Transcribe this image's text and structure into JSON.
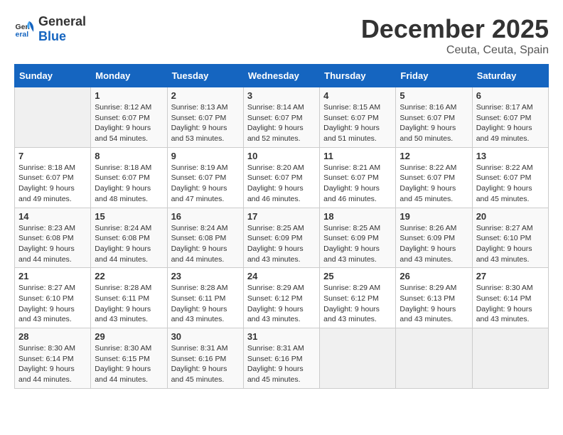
{
  "header": {
    "logo_general": "General",
    "logo_blue": "Blue",
    "month": "December 2025",
    "location": "Ceuta, Ceuta, Spain"
  },
  "weekdays": [
    "Sunday",
    "Monday",
    "Tuesday",
    "Wednesday",
    "Thursday",
    "Friday",
    "Saturday"
  ],
  "weeks": [
    [
      {
        "day": "",
        "sunrise": "",
        "sunset": "",
        "daylight": ""
      },
      {
        "day": "1",
        "sunrise": "Sunrise: 8:12 AM",
        "sunset": "Sunset: 6:07 PM",
        "daylight": "Daylight: 9 hours and 54 minutes."
      },
      {
        "day": "2",
        "sunrise": "Sunrise: 8:13 AM",
        "sunset": "Sunset: 6:07 PM",
        "daylight": "Daylight: 9 hours and 53 minutes."
      },
      {
        "day": "3",
        "sunrise": "Sunrise: 8:14 AM",
        "sunset": "Sunset: 6:07 PM",
        "daylight": "Daylight: 9 hours and 52 minutes."
      },
      {
        "day": "4",
        "sunrise": "Sunrise: 8:15 AM",
        "sunset": "Sunset: 6:07 PM",
        "daylight": "Daylight: 9 hours and 51 minutes."
      },
      {
        "day": "5",
        "sunrise": "Sunrise: 8:16 AM",
        "sunset": "Sunset: 6:07 PM",
        "daylight": "Daylight: 9 hours and 50 minutes."
      },
      {
        "day": "6",
        "sunrise": "Sunrise: 8:17 AM",
        "sunset": "Sunset: 6:07 PM",
        "daylight": "Daylight: 9 hours and 49 minutes."
      }
    ],
    [
      {
        "day": "7",
        "sunrise": "Sunrise: 8:18 AM",
        "sunset": "Sunset: 6:07 PM",
        "daylight": "Daylight: 9 hours and 49 minutes."
      },
      {
        "day": "8",
        "sunrise": "Sunrise: 8:18 AM",
        "sunset": "Sunset: 6:07 PM",
        "daylight": "Daylight: 9 hours and 48 minutes."
      },
      {
        "day": "9",
        "sunrise": "Sunrise: 8:19 AM",
        "sunset": "Sunset: 6:07 PM",
        "daylight": "Daylight: 9 hours and 47 minutes."
      },
      {
        "day": "10",
        "sunrise": "Sunrise: 8:20 AM",
        "sunset": "Sunset: 6:07 PM",
        "daylight": "Daylight: 9 hours and 46 minutes."
      },
      {
        "day": "11",
        "sunrise": "Sunrise: 8:21 AM",
        "sunset": "Sunset: 6:07 PM",
        "daylight": "Daylight: 9 hours and 46 minutes."
      },
      {
        "day": "12",
        "sunrise": "Sunrise: 8:22 AM",
        "sunset": "Sunset: 6:07 PM",
        "daylight": "Daylight: 9 hours and 45 minutes."
      },
      {
        "day": "13",
        "sunrise": "Sunrise: 8:22 AM",
        "sunset": "Sunset: 6:07 PM",
        "daylight": "Daylight: 9 hours and 45 minutes."
      }
    ],
    [
      {
        "day": "14",
        "sunrise": "Sunrise: 8:23 AM",
        "sunset": "Sunset: 6:08 PM",
        "daylight": "Daylight: 9 hours and 44 minutes."
      },
      {
        "day": "15",
        "sunrise": "Sunrise: 8:24 AM",
        "sunset": "Sunset: 6:08 PM",
        "daylight": "Daylight: 9 hours and 44 minutes."
      },
      {
        "day": "16",
        "sunrise": "Sunrise: 8:24 AM",
        "sunset": "Sunset: 6:08 PM",
        "daylight": "Daylight: 9 hours and 44 minutes."
      },
      {
        "day": "17",
        "sunrise": "Sunrise: 8:25 AM",
        "sunset": "Sunset: 6:09 PM",
        "daylight": "Daylight: 9 hours and 43 minutes."
      },
      {
        "day": "18",
        "sunrise": "Sunrise: 8:25 AM",
        "sunset": "Sunset: 6:09 PM",
        "daylight": "Daylight: 9 hours and 43 minutes."
      },
      {
        "day": "19",
        "sunrise": "Sunrise: 8:26 AM",
        "sunset": "Sunset: 6:09 PM",
        "daylight": "Daylight: 9 hours and 43 minutes."
      },
      {
        "day": "20",
        "sunrise": "Sunrise: 8:27 AM",
        "sunset": "Sunset: 6:10 PM",
        "daylight": "Daylight: 9 hours and 43 minutes."
      }
    ],
    [
      {
        "day": "21",
        "sunrise": "Sunrise: 8:27 AM",
        "sunset": "Sunset: 6:10 PM",
        "daylight": "Daylight: 9 hours and 43 minutes."
      },
      {
        "day": "22",
        "sunrise": "Sunrise: 8:28 AM",
        "sunset": "Sunset: 6:11 PM",
        "daylight": "Daylight: 9 hours and 43 minutes."
      },
      {
        "day": "23",
        "sunrise": "Sunrise: 8:28 AM",
        "sunset": "Sunset: 6:11 PM",
        "daylight": "Daylight: 9 hours and 43 minutes."
      },
      {
        "day": "24",
        "sunrise": "Sunrise: 8:29 AM",
        "sunset": "Sunset: 6:12 PM",
        "daylight": "Daylight: 9 hours and 43 minutes."
      },
      {
        "day": "25",
        "sunrise": "Sunrise: 8:29 AM",
        "sunset": "Sunset: 6:12 PM",
        "daylight": "Daylight: 9 hours and 43 minutes."
      },
      {
        "day": "26",
        "sunrise": "Sunrise: 8:29 AM",
        "sunset": "Sunset: 6:13 PM",
        "daylight": "Daylight: 9 hours and 43 minutes."
      },
      {
        "day": "27",
        "sunrise": "Sunrise: 8:30 AM",
        "sunset": "Sunset: 6:14 PM",
        "daylight": "Daylight: 9 hours and 43 minutes."
      }
    ],
    [
      {
        "day": "28",
        "sunrise": "Sunrise: 8:30 AM",
        "sunset": "Sunset: 6:14 PM",
        "daylight": "Daylight: 9 hours and 44 minutes."
      },
      {
        "day": "29",
        "sunrise": "Sunrise: 8:30 AM",
        "sunset": "Sunset: 6:15 PM",
        "daylight": "Daylight: 9 hours and 44 minutes."
      },
      {
        "day": "30",
        "sunrise": "Sunrise: 8:31 AM",
        "sunset": "Sunset: 6:16 PM",
        "daylight": "Daylight: 9 hours and 45 minutes."
      },
      {
        "day": "31",
        "sunrise": "Sunrise: 8:31 AM",
        "sunset": "Sunset: 6:16 PM",
        "daylight": "Daylight: 9 hours and 45 minutes."
      },
      {
        "day": "",
        "sunrise": "",
        "sunset": "",
        "daylight": ""
      },
      {
        "day": "",
        "sunrise": "",
        "sunset": "",
        "daylight": ""
      },
      {
        "day": "",
        "sunrise": "",
        "sunset": "",
        "daylight": ""
      }
    ]
  ]
}
